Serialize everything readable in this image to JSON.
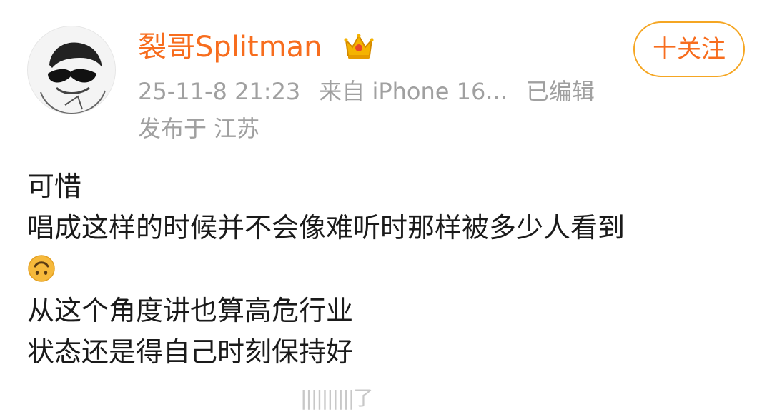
{
  "post": {
    "username": "裂哥Splitman",
    "follow_label": "十关注",
    "timestamp": "25-11-8 21:23",
    "source": "来自 iPhone 16...",
    "edited": "已编辑",
    "location": "发布于 江苏",
    "badge_icon": "crown-icon",
    "avatar_icon": "avatar-sunglasses"
  },
  "body": {
    "line1": "可惜",
    "line2": "唱成这样的时候并不会像难听时那样被多少人看到",
    "emoji": "upside-down-face-emoji",
    "line3": "从这个角度讲也算高危行业",
    "line4": "状态还是得自己时刻保持好"
  },
  "watermark": "||||||||||了",
  "colors": {
    "username": "#f76d1e",
    "follow_border": "#f5a623",
    "meta": "#a0a0a0",
    "text": "#1a1a1a",
    "emoji": "#f6b93b"
  }
}
